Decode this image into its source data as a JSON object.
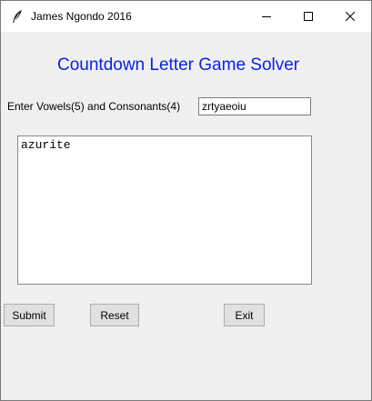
{
  "window": {
    "title": "James Ngondo 2016",
    "icons": {
      "app": "feather-icon",
      "minimize": "minimize-icon",
      "maximize": "maximize-icon",
      "close": "close-icon"
    }
  },
  "app": {
    "title": "Countdown Letter Game Solver",
    "title_color": "#0b22e0"
  },
  "entry": {
    "label": "Enter Vowels(5) and Consonants(4)",
    "value": "zrtyaeoiu"
  },
  "output": {
    "text": "azurite"
  },
  "buttons": {
    "submit": "Submit",
    "reset": "Reset",
    "exit": "Exit"
  }
}
